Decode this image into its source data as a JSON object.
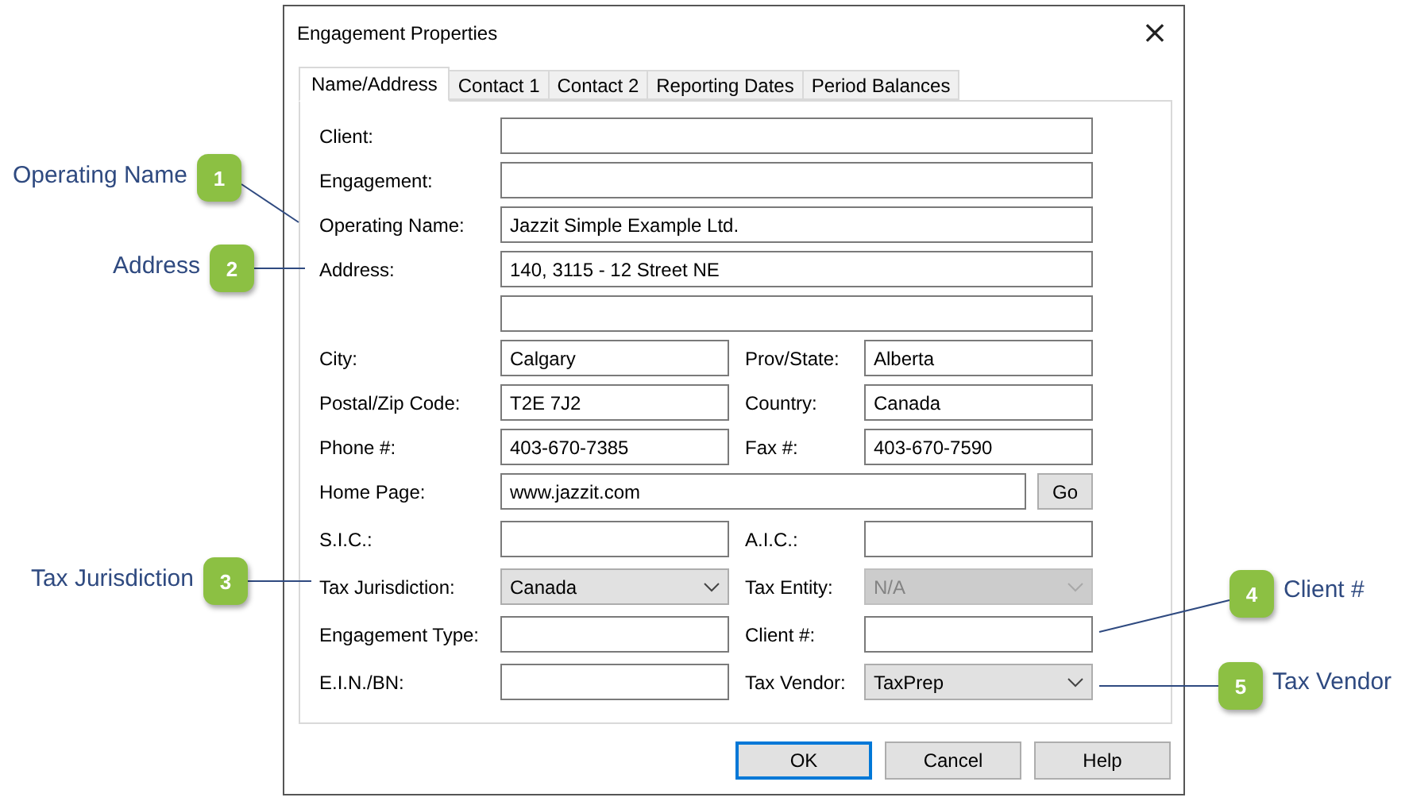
{
  "window": {
    "title": "Engagement Properties",
    "close": "×"
  },
  "tabs": [
    {
      "label": "Name/Address",
      "selected": true
    },
    {
      "label": "Contact 1",
      "selected": false
    },
    {
      "label": "Contact 2",
      "selected": false
    },
    {
      "label": "Reporting Dates",
      "selected": false
    },
    {
      "label": "Period Balances",
      "selected": false
    }
  ],
  "rows": [
    {
      "fields": [
        {
          "label": "Client:",
          "kind": "text",
          "disabled": false
        }
      ]
    },
    {
      "fields": [
        {
          "label": "Engagement:",
          "kind": "text",
          "disabled": false
        }
      ]
    },
    {
      "fields": [
        {
          "label": "Operating Name:",
          "value": "Jazzit Simple Example Ltd.",
          "kind": "text",
          "disabled": false
        }
      ]
    },
    {
      "fields": [
        {
          "label": "Address:",
          "value": "140, 3115 - 12 Street NE",
          "kind": "text",
          "disabled": false
        }
      ]
    },
    {
      "fields": [
        {
          "kind": "text",
          "disabled": false
        }
      ]
    },
    {
      "fields": [
        {
          "label": "City:",
          "value": "Calgary",
          "kind": "text",
          "disabled": false
        },
        {
          "label": "Prov/State:",
          "value": "Alberta",
          "kind": "text",
          "disabled": false
        }
      ]
    },
    {
      "fields": [
        {
          "label": "Postal/Zip Code:",
          "value": "T2E 7J2",
          "kind": "text",
          "disabled": false
        },
        {
          "label": "Country:",
          "value": "Canada",
          "kind": "text",
          "disabled": false
        }
      ]
    },
    {
      "fields": [
        {
          "label": "Phone #:",
          "value": "403-670-7385",
          "kind": "text",
          "disabled": false
        },
        {
          "label": "Fax #:",
          "value": "403-670-7590",
          "kind": "text",
          "disabled": false
        }
      ]
    },
    {
      "fields": [
        {
          "label": "Home Page:",
          "value": "www.jazzit.com",
          "kind": "text_button",
          "button": "Go",
          "disabled": false
        }
      ]
    },
    {
      "fields": [
        {
          "label": "S.I.C.:",
          "kind": "text",
          "disabled": false
        },
        {
          "label": "A.I.C.:",
          "kind": "text",
          "disabled": false
        }
      ]
    },
    {
      "fields": [
        {
          "label": "Tax Jurisdiction:",
          "value": "Canada",
          "kind": "select",
          "disabled": false
        },
        {
          "label": "Tax Entity:",
          "value": "N/A",
          "kind": "select",
          "disabled": true
        }
      ]
    },
    {
      "fields": [
        {
          "label": "Engagement Type:",
          "kind": "text",
          "disabled": false
        },
        {
          "label": "Client #:",
          "kind": "text",
          "disabled": false
        }
      ]
    },
    {
      "fields": [
        {
          "label": "E.I.N./BN:",
          "kind": "text",
          "disabled": false
        },
        {
          "label": "Tax Vendor:",
          "value": "TaxPrep",
          "kind": "select",
          "disabled": false
        }
      ]
    }
  ],
  "buttons": [
    {
      "label": "OK",
      "default": true
    },
    {
      "label": "Cancel",
      "default": false
    },
    {
      "label": "Help",
      "default": false
    }
  ],
  "callouts": [
    {
      "number": "1",
      "label": "Operating Name",
      "kind": "left"
    },
    {
      "number": "2",
      "label": "Address",
      "kind": "left"
    },
    {
      "number": "3",
      "label": "Tax Jurisdiction",
      "kind": "left"
    },
    {
      "number": "4",
      "label": "Client #",
      "kind": "right"
    },
    {
      "number": "5",
      "label": "Tax Vendor",
      "kind": "right"
    }
  ]
}
